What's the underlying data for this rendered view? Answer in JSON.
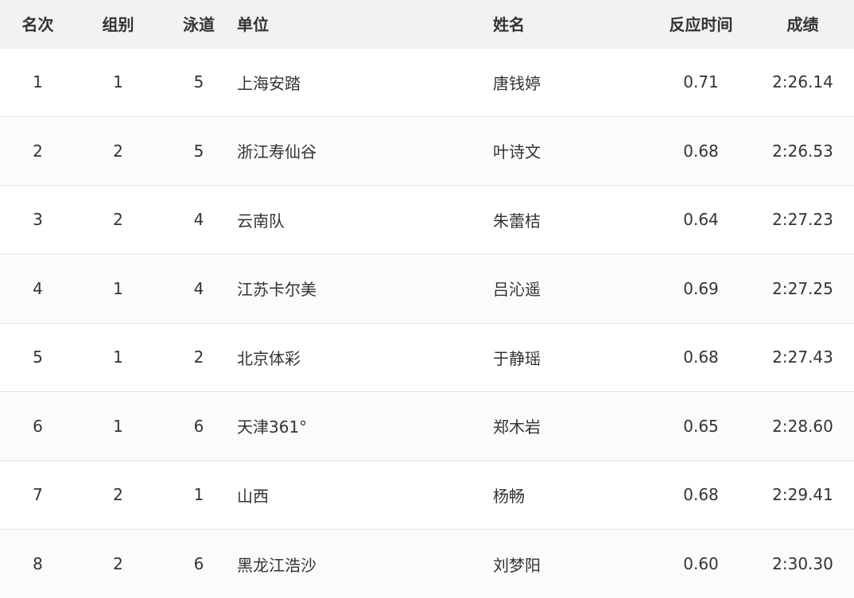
{
  "headers": {
    "rank": "名次",
    "group": "组别",
    "lane": "泳道",
    "unit": "单位",
    "name": "姓名",
    "reaction": "反应时间",
    "result": "成绩"
  },
  "rows": [
    {
      "rank": "1",
      "group": "1",
      "lane": "5",
      "unit": "上海安踏",
      "name": "唐钱婷",
      "reaction": "0.71",
      "result": "2:26.14"
    },
    {
      "rank": "2",
      "group": "2",
      "lane": "5",
      "unit": "浙江寿仙谷",
      "name": "叶诗文",
      "reaction": "0.68",
      "result": "2:26.53"
    },
    {
      "rank": "3",
      "group": "2",
      "lane": "4",
      "unit": "云南队",
      "name": "朱蕾桔",
      "reaction": "0.64",
      "result": "2:27.23"
    },
    {
      "rank": "4",
      "group": "1",
      "lane": "4",
      "unit": "江苏卡尔美",
      "name": "吕沁遥",
      "reaction": "0.69",
      "result": "2:27.25"
    },
    {
      "rank": "5",
      "group": "1",
      "lane": "2",
      "unit": "北京体彩",
      "name": "于静瑶",
      "reaction": "0.68",
      "result": "2:27.43"
    },
    {
      "rank": "6",
      "group": "1",
      "lane": "6",
      "unit": "天津361°",
      "name": "郑木岩",
      "reaction": "0.65",
      "result": "2:28.60"
    },
    {
      "rank": "7",
      "group": "2",
      "lane": "1",
      "unit": "山西",
      "name": "杨畅",
      "reaction": "0.68",
      "result": "2:29.41"
    },
    {
      "rank": "8",
      "group": "2",
      "lane": "6",
      "unit": "黑龙江浩沙",
      "name": "刘梦阳",
      "reaction": "0.60",
      "result": "2:30.30"
    }
  ]
}
